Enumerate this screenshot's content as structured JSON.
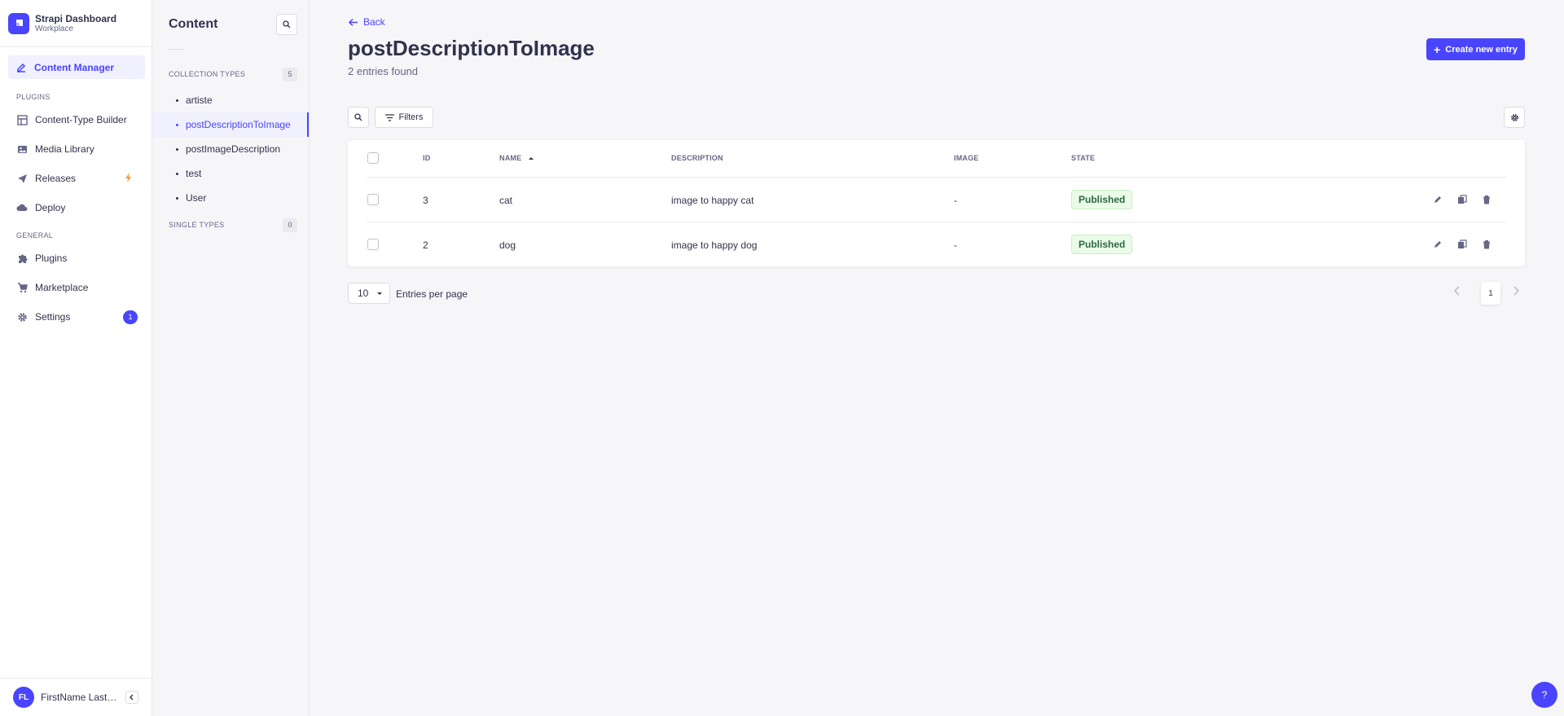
{
  "brand": {
    "title": "Strapi Dashboard",
    "subtitle": "Workplace"
  },
  "mainnav": {
    "active_item": "Content Manager",
    "sections": {
      "plugins": "PLUGINS",
      "general": "GENERAL"
    },
    "plugin_items": [
      "Content-Type Builder",
      "Media Library",
      "Releases",
      "Deploy"
    ],
    "general_items": [
      "Plugins",
      "Marketplace",
      "Settings"
    ],
    "settings_badge": "1"
  },
  "user": {
    "initials": "FL",
    "name": "FirstName LastName"
  },
  "subnav": {
    "title": "Content",
    "collection_label": "COLLECTION TYPES",
    "collection_count": "5",
    "collection_items": [
      "artiste",
      "postDescriptionToImage",
      "postImageDescription",
      "test",
      "User"
    ],
    "single_label": "SINGLE TYPES",
    "single_count": "0"
  },
  "page": {
    "back": "Back",
    "title": "postDescriptionToImage",
    "subtitle": "2 entries found",
    "create_button": "Create new entry",
    "filters_button": "Filters"
  },
  "table": {
    "columns": [
      "ID",
      "NAME",
      "DESCRIPTION",
      "IMAGE",
      "STATE"
    ],
    "rows": [
      {
        "id": "3",
        "name": "cat",
        "description": "image to happy cat",
        "image": "-",
        "state": "Published"
      },
      {
        "id": "2",
        "name": "dog",
        "description": "image to happy dog",
        "image": "-",
        "state": "Published"
      }
    ]
  },
  "pagination": {
    "per_page_value": "10",
    "per_page_label": "Entries per page",
    "current_page": "1"
  },
  "help": "?",
  "colors": {
    "accent": "#4945ff",
    "published_bg": "#eafbe7",
    "published_text": "#2f6846",
    "releases_bolt": "#f29d41"
  }
}
